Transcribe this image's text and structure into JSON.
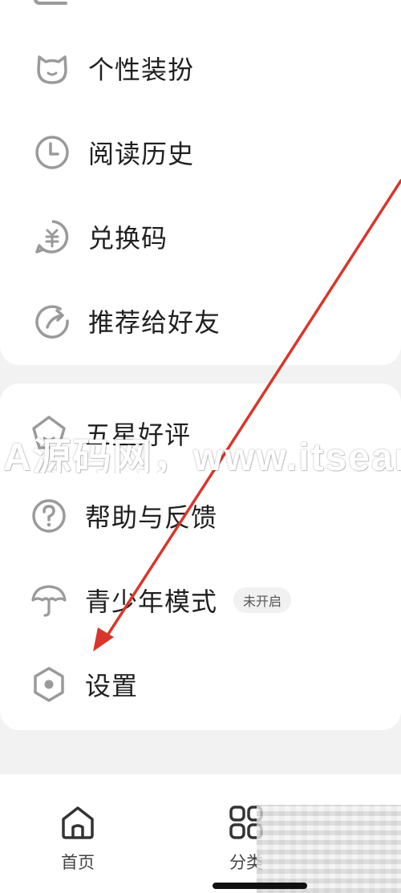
{
  "menu_top": {
    "items": [
      {
        "label": "个性装扮",
        "icon": "cat-icon"
      },
      {
        "label": "阅读历史",
        "icon": "clock-icon"
      },
      {
        "label": "兑换码",
        "icon": "coupon-icon"
      },
      {
        "label": "推荐给好友",
        "icon": "share-icon"
      }
    ]
  },
  "menu_bottom": {
    "items": [
      {
        "label": "五星好评",
        "icon": "star-icon"
      },
      {
        "label": "帮助与反馈",
        "icon": "question-icon"
      },
      {
        "label": "青少年模式",
        "icon": "umbrella-icon",
        "badge": "未开启"
      },
      {
        "label": "设置",
        "icon": "hexagon-gear-icon"
      }
    ]
  },
  "tabbar": {
    "tabs": [
      {
        "label": "首页",
        "icon": "home-icon"
      },
      {
        "label": "分类",
        "icon": "grid-icon"
      }
    ]
  },
  "watermark": "A源码网，www.itsear.com",
  "colors": {
    "icon_gray": "#9a9a9a",
    "arrow_red": "#d9362b"
  }
}
